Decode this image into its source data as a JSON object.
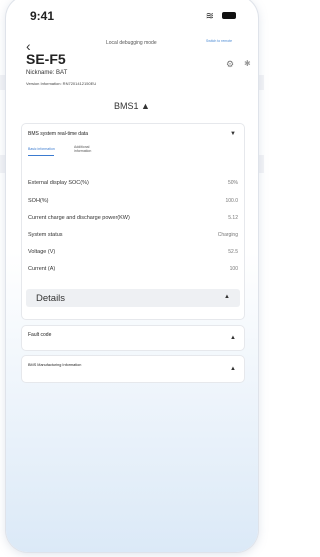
{
  "status_bar": {
    "time": "9:41",
    "wifi_icon": "wifi-icon",
    "battery_icon": "battery-icon"
  },
  "header": {
    "back_icon": "chevron-left-icon",
    "mode_label": "Local debugging mode",
    "mode_tag": "Switch to remote",
    "device_title": "SE-F5",
    "nickname": "Nickname: BAT",
    "version_info": "Version Information: RN7201412150EU",
    "settings_icon": "gear-icon",
    "bluetooth_icon": "bluetooth-icon"
  },
  "bms_selector": {
    "label": "BMS1 ▲"
  },
  "realtime_panel": {
    "title": "BMS system real-time data",
    "tabs": [
      "Basic information",
      "Additional information"
    ],
    "active_tab": 0,
    "rows": [
      {
        "label": "External display SOC(%)",
        "value": "50%"
      },
      {
        "label": "SOH(%)",
        "value": "100.0"
      },
      {
        "label": "Current charge and discharge power(KW)",
        "value": "5.12"
      },
      {
        "label": "System status",
        "value": "Charging"
      },
      {
        "label": "Voltage (V)",
        "value": "52.5"
      },
      {
        "label": "Current (A)",
        "value": "100"
      }
    ],
    "details_label": "Details"
  },
  "fault_panel": {
    "title": "Fault code"
  },
  "manufacturing_panel": {
    "title": "BMS Manufacturing Information"
  },
  "colors": {
    "accent": "#3b7bd0",
    "bg_bottom": "#dbe9f7"
  }
}
